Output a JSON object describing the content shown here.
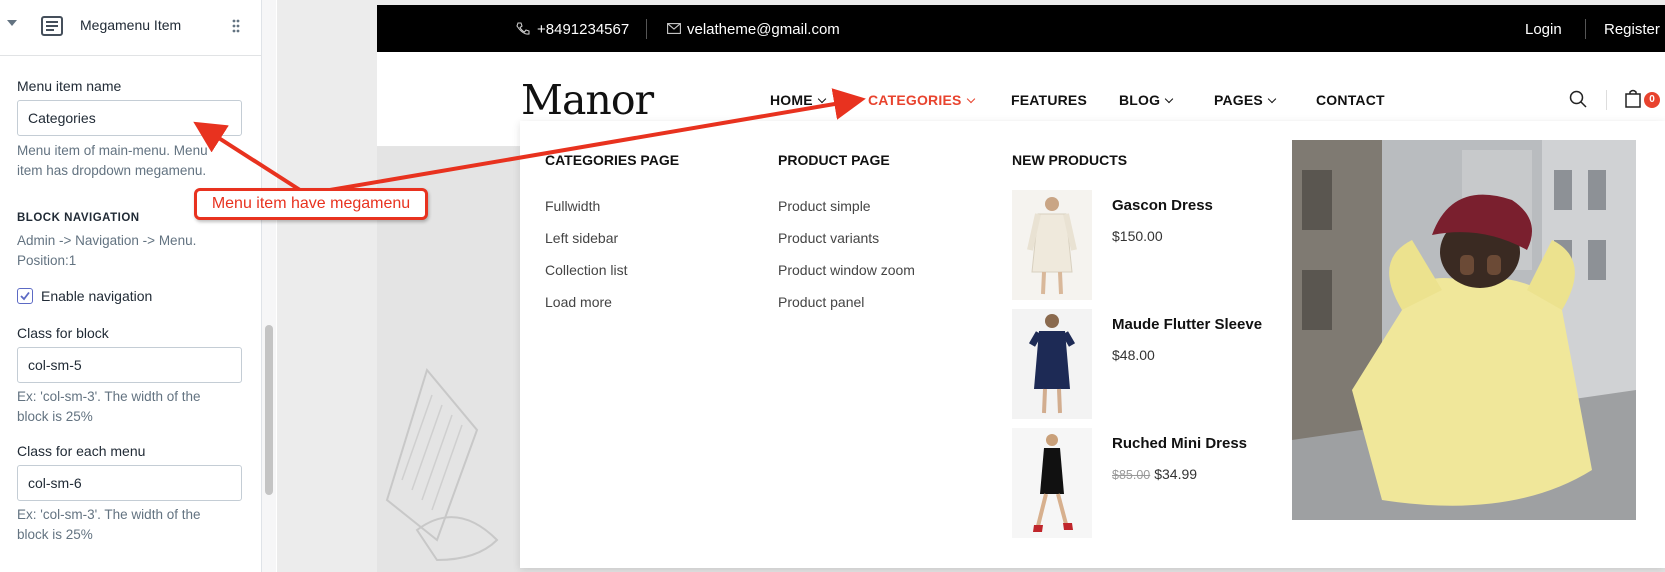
{
  "editor": {
    "header_title": "Megamenu Item",
    "menu_item_name_label": "Menu item name",
    "menu_item_name_value": "Categories",
    "menu_item_help_line1": "Menu item of main-menu. Menu",
    "menu_item_help_line2": "item has dropdown megamenu.",
    "block_nav_heading": "BLOCK NAVIGATION",
    "block_nav_help_line1": "Admin -> Navigation -> Menu.",
    "block_nav_help_line2": "Position:1",
    "enable_nav_label": "Enable navigation",
    "enable_nav_checked": true,
    "class_block_label": "Class for block",
    "class_block_value": "col-sm-5",
    "class_block_help_line1": "Ex: 'col-sm-3'. The width of the",
    "class_block_help_line2": "block is 25%",
    "class_menu_label": "Class for each menu",
    "class_menu_value": "col-sm-6",
    "class_menu_help_line1": "Ex: 'col-sm-3'. The width of the",
    "class_menu_help_line2": "block is 25%"
  },
  "annotation": {
    "callout_text": "Menu item have megamenu",
    "color": "#e8321f"
  },
  "site": {
    "phone": "+8491234567",
    "email": "velatheme@gmail.com",
    "login": "Login",
    "register": "Register",
    "logo": "Manor",
    "cart_count": "0",
    "nav": [
      {
        "label": "HOME"
      },
      {
        "label": "CATEGORIES"
      },
      {
        "label": "FEATURES"
      },
      {
        "label": "BLOG"
      },
      {
        "label": "PAGES"
      },
      {
        "label": "CONTACT"
      }
    ],
    "accent_color": "#e8432e"
  },
  "megamenu": {
    "columns": [
      {
        "title": "CATEGORIES PAGE",
        "links": [
          "Fullwidth",
          "Left sidebar",
          "Collection list",
          "Load more"
        ]
      },
      {
        "title": "PRODUCT PAGE",
        "links": [
          "Product simple",
          "Product variants",
          "Product window zoom",
          "Product panel"
        ]
      }
    ],
    "new_products_title": "NEW PRODUCTS",
    "products": [
      {
        "name": "Gascon Dress",
        "price": "$150.00",
        "old_price": ""
      },
      {
        "name": "Maude Flutter Sleeve",
        "price": "$48.00",
        "old_price": ""
      },
      {
        "name": "Ruched Mini Dress",
        "price": "$34.99",
        "old_price": "$85.00"
      }
    ]
  }
}
